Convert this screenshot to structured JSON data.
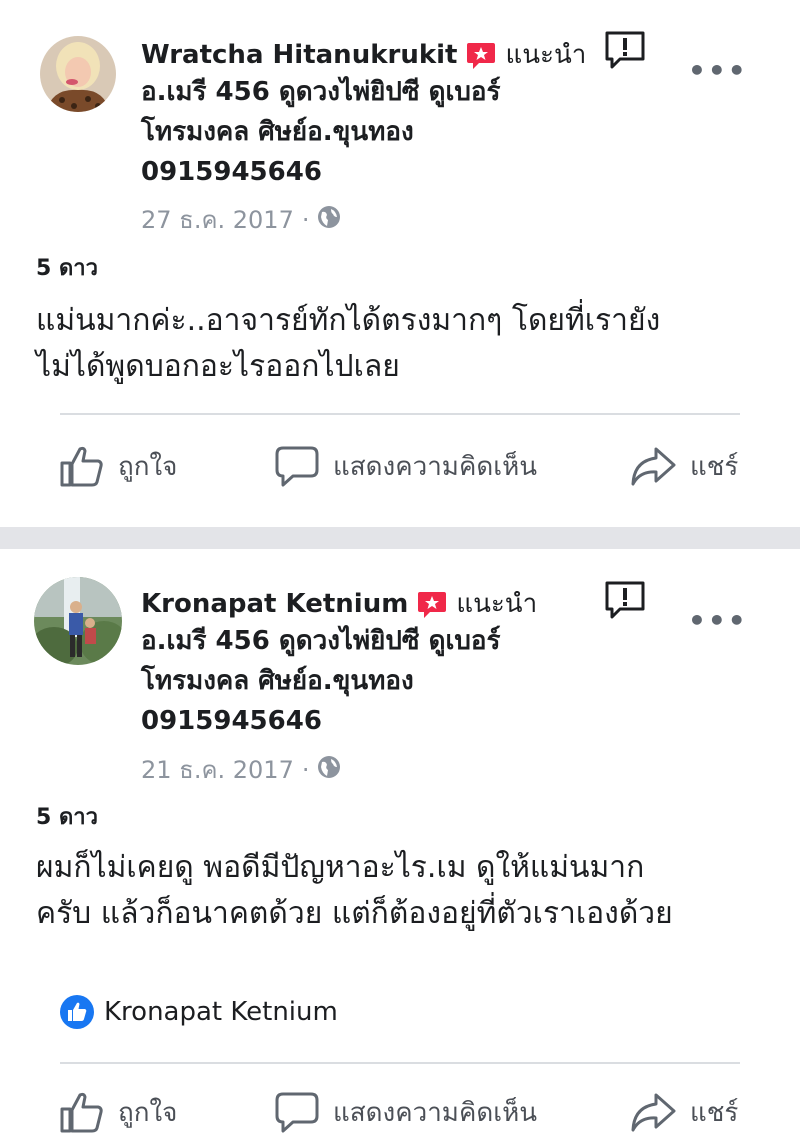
{
  "posts": [
    {
      "author": "Wratcha Hitanukrukit",
      "recommends": "แนะนำ",
      "page_lines": [
        "อ.เมรี 456 ดูดวงไพ่ยิปซี ดูเบอร์",
        "โทรมงคล ศิษย์อ.ขุนทอง",
        "0915945646"
      ],
      "date": "27 ธ.ค. 2017",
      "rating": "5 ดาว",
      "review_lines": [
        "แม่นมากค่ะ..อาจารย์ทักได้ตรงมากๆ โดยที่เรายัง",
        "ไม่ได้พูดบอกอะไรออกไปเลย"
      ],
      "liker": ""
    },
    {
      "author": "Kronapat Ketnium",
      "recommends": "แนะนำ",
      "page_lines": [
        "อ.เมรี 456 ดูดวงไพ่ยิปซี ดูเบอร์",
        "โทรมงคล ศิษย์อ.ขุนทอง",
        "0915945646"
      ],
      "date": "21 ธ.ค. 2017",
      "rating": "5 ดาว",
      "review_lines": [
        "ผมก็ไม่เคยดู พอดีมีปัญหาอะไร.เม ดูให้แม่นมาก",
        "ครับ แล้วก็อนาคตด้วย แต่ก็ต้องอยู่ที่ตัวเราเองด้วย"
      ],
      "liker": "Kronapat Ketnium"
    }
  ],
  "actions": {
    "like": "ถูกใจ",
    "comment": "แสดงความคิดเห็น",
    "share": "แชร์"
  },
  "icons": {
    "recommend_badge": "recommend-badge-icon",
    "report": "report-icon",
    "more": "more-options-icon",
    "privacy": "globe-icon",
    "like": "thumbs-up-icon",
    "comment": "comment-bubble-icon",
    "share": "share-arrow-icon"
  },
  "colors": {
    "badge_red": "#f02849",
    "like_blue": "#1877f2",
    "muted_text": "#8d949e",
    "separator": "#e3e4e8"
  },
  "more_glyph": "•••"
}
